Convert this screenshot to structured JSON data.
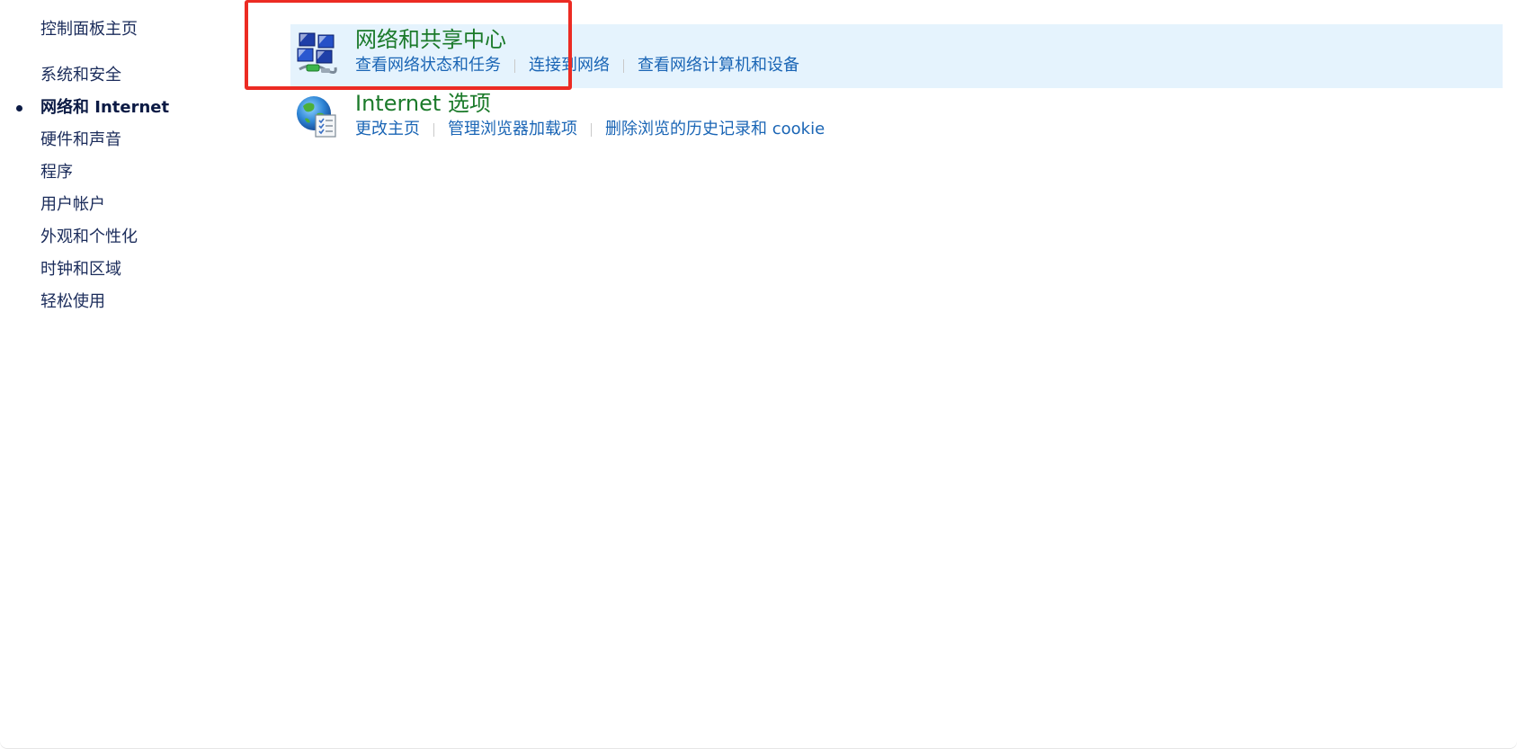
{
  "sidebar": {
    "home": "控制面板主页",
    "items": [
      {
        "label": "系统和安全",
        "current": false
      },
      {
        "label": "网络和 Internet",
        "current": true
      },
      {
        "label": "硬件和声音",
        "current": false
      },
      {
        "label": "程序",
        "current": false
      },
      {
        "label": "用户帐户",
        "current": false
      },
      {
        "label": "外观和个性化",
        "current": false
      },
      {
        "label": "时钟和区域",
        "current": false
      },
      {
        "label": "轻松使用",
        "current": false
      }
    ]
  },
  "categories": [
    {
      "title": "网络和共享中心",
      "icon": "network-sharing-center-icon",
      "highlighted": true,
      "links": [
        "查看网络状态和任务",
        "连接到网络",
        "查看网络计算机和设备"
      ]
    },
    {
      "title": "Internet 选项",
      "icon": "internet-options-globe-icon",
      "highlighted": false,
      "links": [
        "更改主页",
        "管理浏览器加载项",
        "删除浏览的历史记录和 cookie"
      ]
    }
  ],
  "colors": {
    "title_green": "#1b7a2a",
    "link_blue": "#1a65b5",
    "highlight_bg": "#e5f3fd",
    "annotation_red": "#ec2b23"
  }
}
